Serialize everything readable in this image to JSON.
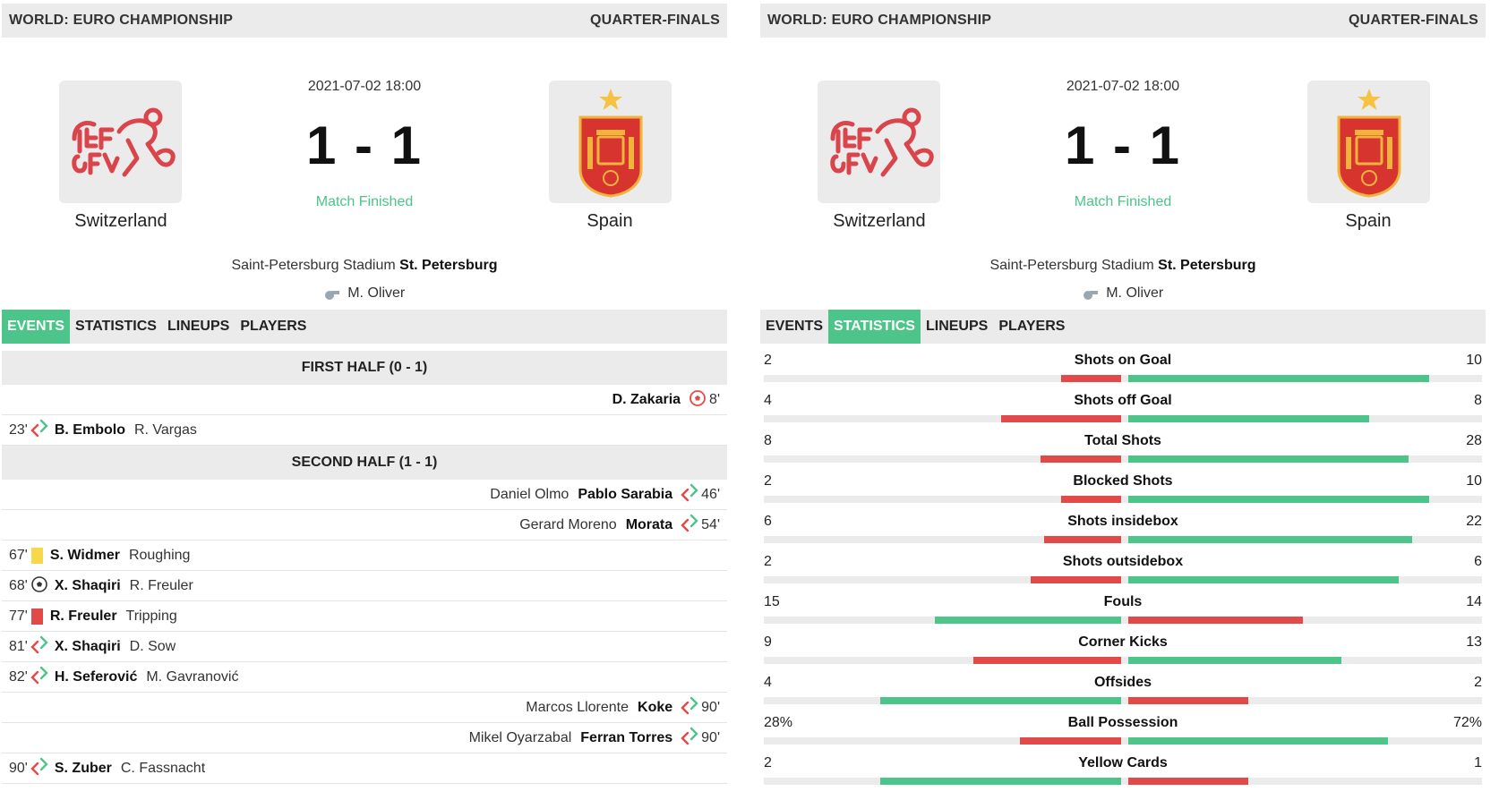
{
  "colors": {
    "accent": "#4cc48a",
    "red": "#e24a4a",
    "green": "#4cc48a",
    "header_bg": "#ebebeb",
    "yellow_card": "#f7d84a"
  },
  "header": {
    "competition": "WORLD: EURO CHAMPIONSHIP",
    "round": "QUARTER-FINALS"
  },
  "match": {
    "datetime": "2021-07-02 18:00",
    "score": "1 - 1",
    "status": "Match Finished",
    "home_team": "Switzerland",
    "away_team": "Spain",
    "venue_stadium": "Saint-Petersburg Stadium",
    "venue_city": "St. Petersburg",
    "referee": "M. Oliver",
    "home_logo_icon": "swiss-football-association-logo-icon",
    "away_logo_icon": "spain-rfef-crest-icon"
  },
  "tabs": [
    "EVENTS",
    "STATISTICS",
    "LINEUPS",
    "PLAYERS"
  ],
  "left_active_tab": 0,
  "right_active_tab": 1,
  "events": {
    "first_half_title": "FIRST HALF (0 - 1)",
    "second_half_title": "SECOND HALF (1 - 1)",
    "first_half": [
      {
        "side": "away",
        "minute": "8'",
        "icon": "own-goal-icon",
        "player": "D. Zakaria",
        "secondary": ""
      },
      {
        "side": "home",
        "minute": "23'",
        "icon": "substitution-icon",
        "player": "B. Embolo",
        "secondary": "R. Vargas"
      }
    ],
    "second_half": [
      {
        "side": "away",
        "minute": "46'",
        "icon": "substitution-icon",
        "player": "Pablo Sarabia",
        "secondary": "Daniel Olmo"
      },
      {
        "side": "away",
        "minute": "54'",
        "icon": "substitution-icon",
        "player": "Morata",
        "secondary": "Gerard Moreno"
      },
      {
        "side": "home",
        "minute": "67'",
        "icon": "yellow-card-icon",
        "player": "S. Widmer",
        "secondary": "Roughing"
      },
      {
        "side": "home",
        "minute": "68'",
        "icon": "goal-ball-icon",
        "player": "X. Shaqiri",
        "secondary": "R. Freuler"
      },
      {
        "side": "home",
        "minute": "77'",
        "icon": "red-card-icon",
        "player": "R. Freuler",
        "secondary": "Tripping"
      },
      {
        "side": "home",
        "minute": "81'",
        "icon": "substitution-icon",
        "player": "X. Shaqiri",
        "secondary": "D. Sow"
      },
      {
        "side": "home",
        "minute": "82'",
        "icon": "substitution-icon",
        "player": "H. Seferović",
        "secondary": "M. Gavranović"
      },
      {
        "side": "away",
        "minute": "90'",
        "icon": "substitution-icon",
        "player": "Koke",
        "secondary": "Marcos Llorente"
      },
      {
        "side": "away",
        "minute": "90'",
        "icon": "substitution-icon",
        "player": "Ferran Torres",
        "secondary": "Mikel Oyarzabal"
      },
      {
        "side": "home",
        "minute": "90'",
        "icon": "substitution-icon",
        "player": "S. Zuber",
        "secondary": "C. Fassnacht"
      }
    ]
  },
  "statistics": [
    {
      "name": "Shots on Goal",
      "home": "2",
      "away": "10",
      "home_share": 0.1667,
      "away_share": 0.8333,
      "home_color": "red",
      "away_color": "green"
    },
    {
      "name": "Shots off Goal",
      "home": "4",
      "away": "8",
      "home_share": 0.3333,
      "away_share": 0.6667,
      "home_color": "red",
      "away_color": "green"
    },
    {
      "name": "Total Shots",
      "home": "8",
      "away": "28",
      "home_share": 0.2222,
      "away_share": 0.7778,
      "home_color": "red",
      "away_color": "green"
    },
    {
      "name": "Blocked Shots",
      "home": "2",
      "away": "10",
      "home_share": 0.1667,
      "away_share": 0.8333,
      "home_color": "red",
      "away_color": "green"
    },
    {
      "name": "Shots insidebox",
      "home": "6",
      "away": "22",
      "home_share": 0.2143,
      "away_share": 0.7857,
      "home_color": "red",
      "away_color": "green"
    },
    {
      "name": "Shots outsidebox",
      "home": "2",
      "away": "6",
      "home_share": 0.25,
      "away_share": 0.75,
      "home_color": "red",
      "away_color": "green"
    },
    {
      "name": "Fouls",
      "home": "15",
      "away": "14",
      "home_share": 0.5172,
      "away_share": 0.4828,
      "home_color": "green",
      "away_color": "red"
    },
    {
      "name": "Corner Kicks",
      "home": "9",
      "away": "13",
      "home_share": 0.4091,
      "away_share": 0.5909,
      "home_color": "red",
      "away_color": "green"
    },
    {
      "name": "Offsides",
      "home": "4",
      "away": "2",
      "home_share": 0.6667,
      "away_share": 0.3333,
      "home_color": "green",
      "away_color": "red"
    },
    {
      "name": "Ball Possession",
      "home": "28%",
      "away": "72%",
      "home_share": 0.28,
      "away_share": 0.72,
      "home_color": "red",
      "away_color": "green"
    },
    {
      "name": "Yellow Cards",
      "home": "2",
      "away": "1",
      "home_share": 0.6667,
      "away_share": 0.3333,
      "home_color": "green",
      "away_color": "red"
    }
  ]
}
